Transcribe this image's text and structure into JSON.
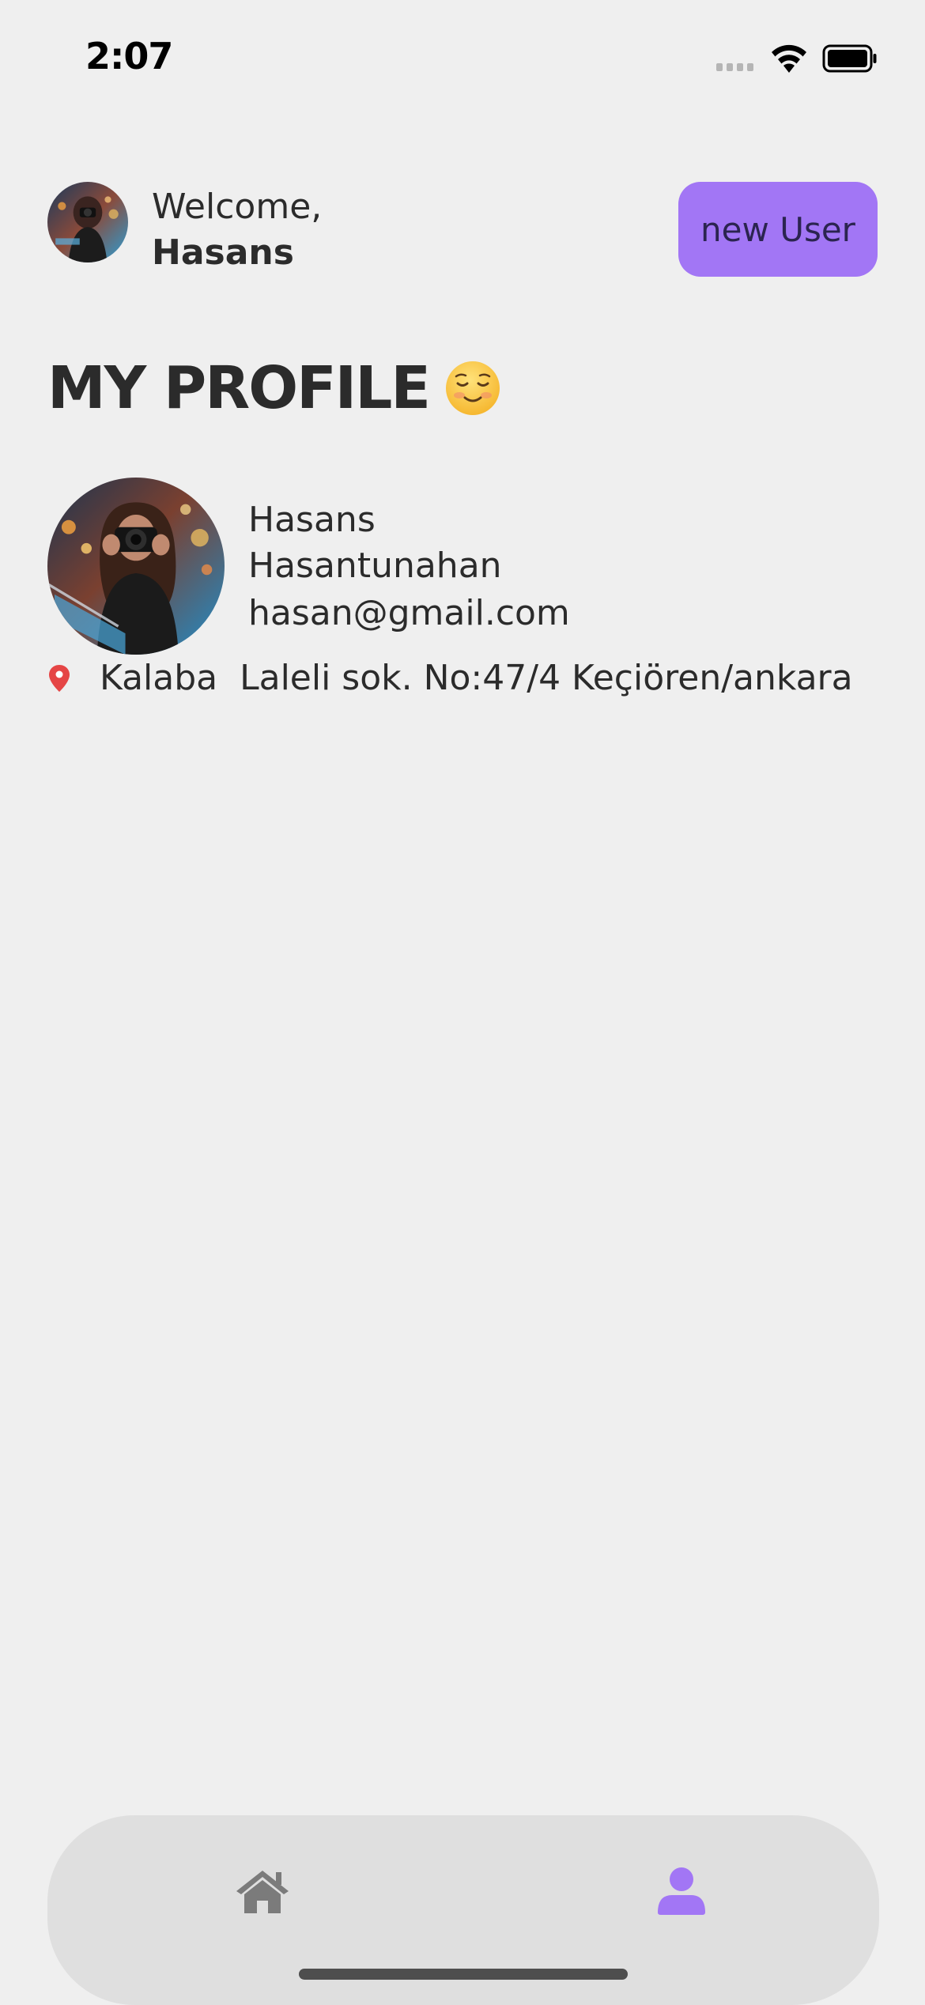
{
  "status_bar": {
    "time": "2:07"
  },
  "header": {
    "welcome_text": "Welcome,",
    "user_name": "Hasans",
    "new_user_button": "new User"
  },
  "profile": {
    "title": "MY PROFILE",
    "first_name": "Hasans",
    "last_name": "Hasantunahan",
    "email": "hasan@gmail.com",
    "address": "Kalaba  Laleli sok. No:47/4 Keçiören/ankara"
  },
  "bottom_nav": {
    "items": [
      {
        "name": "home",
        "icon": "home-icon",
        "active": false
      },
      {
        "name": "profile",
        "icon": "person-icon",
        "active": true
      }
    ]
  },
  "colors": {
    "background": "#efefef",
    "accent": "#a276f5",
    "nav_background": "#dfdfdf",
    "inactive_icon": "#7b7b7b",
    "pin_red": "#e54545"
  }
}
